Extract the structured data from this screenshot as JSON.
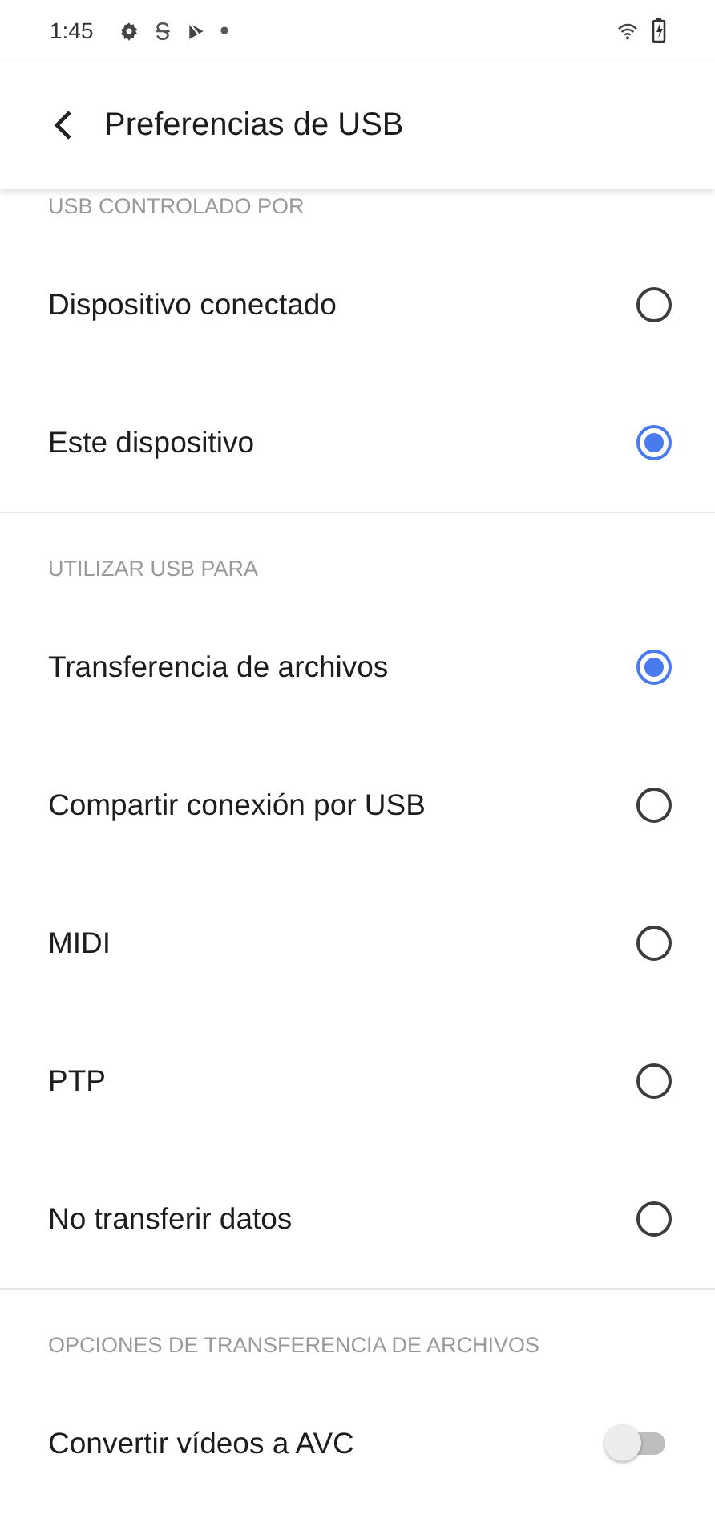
{
  "status_bar": {
    "time": "1:45"
  },
  "app_bar": {
    "title": "Preferencias de USB"
  },
  "sections": [
    {
      "header": "USB CONTROLADO POR",
      "items": [
        {
          "kind": "radio",
          "label": "Dispositivo conectado",
          "selected": false
        },
        {
          "kind": "radio",
          "label": "Este dispositivo",
          "selected": true
        }
      ]
    },
    {
      "header": "UTILIZAR USB PARA",
      "items": [
        {
          "kind": "radio",
          "label": "Transferencia de archivos",
          "selected": true
        },
        {
          "kind": "radio",
          "label": "Compartir conexión por USB",
          "selected": false
        },
        {
          "kind": "radio",
          "label": "MIDI",
          "selected": false
        },
        {
          "kind": "radio",
          "label": "PTP",
          "selected": false
        },
        {
          "kind": "radio",
          "label": "No transferir datos",
          "selected": false
        }
      ]
    },
    {
      "header": "OPCIONES DE TRANSFERENCIA DE ARCHIVOS",
      "items": [
        {
          "kind": "switch",
          "label": "Convertir vídeos a AVC",
          "on": false
        }
      ]
    }
  ]
}
